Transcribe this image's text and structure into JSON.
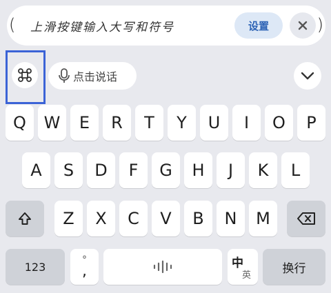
{
  "hint": {
    "text": "上滑按键输入大写和符号",
    "settings_label": "设置"
  },
  "toolbar": {
    "voice_label": "点击说话"
  },
  "keyboard": {
    "row1": [
      "Q",
      "W",
      "E",
      "R",
      "T",
      "Y",
      "U",
      "I",
      "O",
      "P"
    ],
    "row2": [
      "A",
      "S",
      "D",
      "F",
      "G",
      "H",
      "J",
      "K",
      "L"
    ],
    "row3": [
      "Z",
      "X",
      "C",
      "V",
      "B",
      "N",
      "M"
    ],
    "num_label": "123",
    "punct_top": "°",
    "punct_bottom": ",",
    "lang_top": "中",
    "lang_bottom": "英",
    "enter_label": "换行"
  },
  "colors": {
    "accent": "#2d63b5",
    "highlight": "#3b63d6",
    "background": "#e8e9ee"
  }
}
